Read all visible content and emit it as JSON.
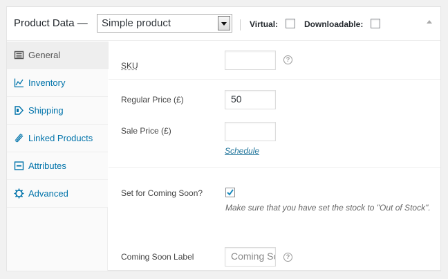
{
  "header": {
    "title": "Product Data —",
    "product_type": "Simple product",
    "virtual_label": "Virtual:",
    "downloadable_label": "Downloadable:"
  },
  "tabs": [
    {
      "label": "General",
      "icon": "general-icon",
      "active": true
    },
    {
      "label": "Inventory",
      "icon": "inventory-icon",
      "active": false
    },
    {
      "label": "Shipping",
      "icon": "shipping-icon",
      "active": false
    },
    {
      "label": "Linked Products",
      "icon": "link-icon",
      "active": false
    },
    {
      "label": "Attributes",
      "icon": "attributes-icon",
      "active": false
    },
    {
      "label": "Advanced",
      "icon": "gear-icon",
      "active": false
    }
  ],
  "fields": {
    "sku_label": "SKU",
    "sku_value": "",
    "regular_price_label": "Regular Price (£)",
    "regular_price_value": "50",
    "sale_price_label": "Sale Price (£)",
    "sale_price_value": "",
    "schedule_link": "Schedule",
    "coming_soon_label": "Set for Coming Soon?",
    "coming_soon_checked": true,
    "coming_soon_description": "Make sure that you have set the stock to \"Out of Stock\".",
    "coming_soon_text_label": "Coming Soon Label",
    "coming_soon_text_placeholder": "Coming Soon"
  },
  "colors": {
    "link": "#0073aa",
    "border": "#e5e5e5",
    "tab_active_bg": "#eeeeee"
  }
}
